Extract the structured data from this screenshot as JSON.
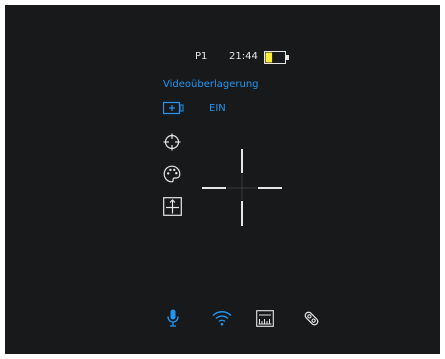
{
  "status_bar": {
    "profile": "P1",
    "time": "21:44",
    "battery_level": 0.35,
    "battery_fill_color": "#ffeb3b",
    "battery_outline_color": "#e6e6e6"
  },
  "menu": {
    "title": "Videoüberlagerung",
    "items": [
      {
        "icon": "video-overlay-icon",
        "value": "EIN",
        "selected": true
      },
      {
        "icon": "crosshair-target-icon",
        "value": "",
        "selected": false
      },
      {
        "icon": "palette-icon",
        "value": "",
        "selected": false
      },
      {
        "icon": "reticle-position-icon",
        "value": "",
        "selected": false
      }
    ]
  },
  "reticle": {
    "type": "crosshair",
    "color": "#e6e6e6"
  },
  "bottom_bar": {
    "items": [
      {
        "icon": "microphone-icon",
        "active": true
      },
      {
        "icon": "wifi-icon",
        "active": true
      },
      {
        "icon": "rangefinder-ruler-icon",
        "active": false
      },
      {
        "icon": "ultrasonic-sensor-icon",
        "active": false
      }
    ]
  },
  "colors": {
    "background": "#17191b",
    "accent": "#2196f3",
    "foreground": "#e6e6e6"
  }
}
